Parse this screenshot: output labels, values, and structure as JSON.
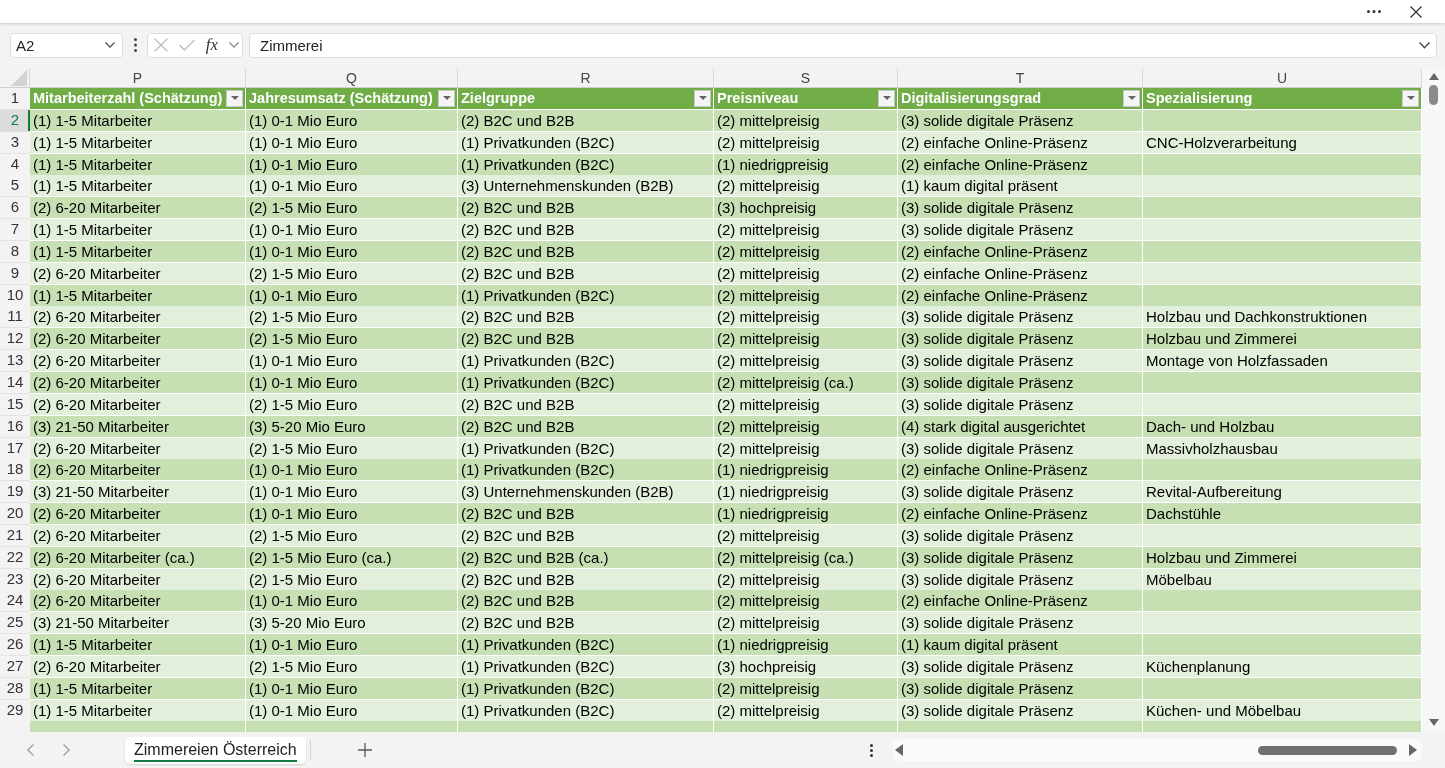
{
  "formula_bar": {
    "name_box": "A2",
    "function_label": "fx",
    "formula": "Zimmerei"
  },
  "sheet": {
    "columns": [
      {
        "letter": "P",
        "title": "Mitarbeiterzahl (Schätzung)"
      },
      {
        "letter": "Q",
        "title": "Jahresumsatz (Schätzung)"
      },
      {
        "letter": "R",
        "title": "Zielgruppe"
      },
      {
        "letter": "S",
        "title": "Preisniveau"
      },
      {
        "letter": "T",
        "title": "Digitalisierungsgrad"
      },
      {
        "letter": "U",
        "title": "Spezialisierung"
      }
    ],
    "header_row_number": "1",
    "rows": [
      {
        "number": "2",
        "selected": true,
        "cells": [
          "(1) 1-5 Mitarbeiter",
          "(1) 0-1 Mio Euro",
          "(2) B2C und B2B",
          "(2) mittelpreisig",
          "(3) solide digitale Präsenz"
        ]
      },
      {
        "number": "3",
        "selected": false,
        "cells": [
          "(1) 1-5 Mitarbeiter",
          "(1) 0-1 Mio Euro",
          "(1) Privatkunden (B2C)",
          "(2) mittelpreisig",
          "(2) einfache Online-Präsenz",
          "CNC-Holzverarbeitung"
        ]
      },
      {
        "number": "4",
        "selected": false,
        "cells": [
          "(1) 1-5 Mitarbeiter",
          "(1) 0-1 Mio Euro",
          "(1) Privatkunden (B2C)",
          "(1) niedrigpreisig",
          "(2) einfache Online-Präsenz"
        ]
      },
      {
        "number": "5",
        "selected": false,
        "cells": [
          "(1) 1-5 Mitarbeiter",
          "(1) 0-1 Mio Euro",
          "(3) Unternehmenskunden (B2B)",
          "(2) mittelpreisig",
          "(1) kaum digital präsent"
        ]
      },
      {
        "number": "6",
        "selected": false,
        "cells": [
          "(2) 6-20 Mitarbeiter",
          "(2) 1-5 Mio Euro",
          "(2) B2C und B2B",
          "(3) hochpreisig",
          "(3) solide digitale Präsenz"
        ]
      },
      {
        "number": "7",
        "selected": false,
        "cells": [
          "(1) 1-5 Mitarbeiter",
          "(1) 0-1 Mio Euro",
          "(2) B2C und B2B",
          "(2) mittelpreisig",
          "(3) solide digitale Präsenz"
        ]
      },
      {
        "number": "8",
        "selected": false,
        "cells": [
          "(1) 1-5 Mitarbeiter",
          "(1) 0-1 Mio Euro",
          "(2) B2C und B2B",
          "(2) mittelpreisig",
          "(2) einfache Online-Präsenz"
        ]
      },
      {
        "number": "9",
        "selected": false,
        "cells": [
          "(2) 6-20 Mitarbeiter",
          "(2) 1-5 Mio Euro",
          "(2) B2C und B2B",
          "(2) mittelpreisig",
          "(2) einfache Online-Präsenz"
        ]
      },
      {
        "number": "10",
        "selected": false,
        "cells": [
          "(1) 1-5 Mitarbeiter",
          "(1) 0-1 Mio Euro",
          "(1) Privatkunden (B2C)",
          "(2) mittelpreisig",
          "(2) einfache Online-Präsenz"
        ]
      },
      {
        "number": "11",
        "selected": false,
        "cells": [
          "(2) 6-20 Mitarbeiter",
          "(2) 1-5 Mio Euro",
          "(2) B2C und B2B",
          "(2) mittelpreisig",
          "(3) solide digitale Präsenz",
          "Holzbau und Dachkonstruktionen"
        ]
      },
      {
        "number": "12",
        "selected": false,
        "cells": [
          "(2) 6-20 Mitarbeiter",
          "(2) 1-5 Mio Euro",
          "(2) B2C und B2B",
          "(2) mittelpreisig",
          "(3) solide digitale Präsenz",
          "Holzbau und Zimmerei"
        ]
      },
      {
        "number": "13",
        "selected": false,
        "cells": [
          "(2) 6-20 Mitarbeiter",
          "(1) 0-1 Mio Euro",
          "(1) Privatkunden (B2C)",
          "(2) mittelpreisig",
          "(3) solide digitale Präsenz",
          "Montage von Holzfassaden"
        ]
      },
      {
        "number": "14",
        "selected": false,
        "cells": [
          "(2) 6-20 Mitarbeiter",
          "(1) 0-1 Mio Euro",
          "(1) Privatkunden (B2C)",
          "(2) mittelpreisig (ca.)",
          "(3) solide digitale Präsenz"
        ]
      },
      {
        "number": "15",
        "selected": false,
        "cells": [
          "(2) 6-20 Mitarbeiter",
          "(2) 1-5 Mio Euro",
          "(2) B2C und B2B",
          "(2) mittelpreisig",
          "(3) solide digitale Präsenz"
        ]
      },
      {
        "number": "16",
        "selected": false,
        "cells": [
          "(3) 21-50 Mitarbeiter",
          "(3) 5-20 Mio Euro",
          "(2) B2C und B2B",
          "(2) mittelpreisig",
          "(4) stark digital ausgerichtet",
          "Dach- und Holzbau"
        ]
      },
      {
        "number": "17",
        "selected": false,
        "cells": [
          "(2) 6-20 Mitarbeiter",
          "(2) 1-5 Mio Euro",
          "(1) Privatkunden (B2C)",
          "(2) mittelpreisig",
          "(3) solide digitale Präsenz",
          "Massivholzhausbau"
        ]
      },
      {
        "number": "18",
        "selected": false,
        "cells": [
          "(2) 6-20 Mitarbeiter",
          "(1) 0-1 Mio Euro",
          "(1) Privatkunden (B2C)",
          "(1) niedrigpreisig",
          "(2) einfache Online-Präsenz"
        ]
      },
      {
        "number": "19",
        "selected": false,
        "cells": [
          "(3) 21-50 Mitarbeiter",
          "(1) 0-1 Mio Euro",
          "(3) Unternehmenskunden (B2B)",
          "(1) niedrigpreisig",
          "(3) solide digitale Präsenz",
          "Revital-Aufbereitung"
        ]
      },
      {
        "number": "20",
        "selected": false,
        "cells": [
          "(2) 6-20 Mitarbeiter",
          "(1) 0-1 Mio Euro",
          "(2) B2C und B2B",
          "(1) niedrigpreisig",
          "(2) einfache Online-Präsenz",
          "Dachstühle"
        ]
      },
      {
        "number": "21",
        "selected": false,
        "cells": [
          "(2) 6-20 Mitarbeiter",
          "(2) 1-5 Mio Euro",
          "(2) B2C und B2B",
          "(2) mittelpreisig",
          "(3) solide digitale Präsenz"
        ]
      },
      {
        "number": "22",
        "selected": false,
        "cells": [
          "(2) 6-20 Mitarbeiter (ca.)",
          "(2) 1-5 Mio Euro (ca.)",
          "(2) B2C und B2B (ca.)",
          "(2) mittelpreisig (ca.)",
          "(3) solide digitale Präsenz",
          "Holzbau und Zimmerei"
        ]
      },
      {
        "number": "23",
        "selected": false,
        "cells": [
          "(2) 6-20 Mitarbeiter",
          "(2) 1-5 Mio Euro",
          "(2) B2C und B2B",
          "(2) mittelpreisig",
          "(3) solide digitale Präsenz",
          "Möbelbau"
        ]
      },
      {
        "number": "24",
        "selected": false,
        "cells": [
          "(2) 6-20 Mitarbeiter",
          "(1) 0-1 Mio Euro",
          "(2) B2C und B2B",
          "(2) mittelpreisig",
          "(2) einfache Online-Präsenz"
        ]
      },
      {
        "number": "25",
        "selected": false,
        "cells": [
          "(3) 21-50 Mitarbeiter",
          "(3) 5-20 Mio Euro",
          "(2) B2C und B2B",
          "(2) mittelpreisig",
          "(3) solide digitale Präsenz"
        ]
      },
      {
        "number": "26",
        "selected": false,
        "cells": [
          "(1) 1-5 Mitarbeiter",
          "(1) 0-1 Mio Euro",
          "(1) Privatkunden (B2C)",
          "(1) niedrigpreisig",
          "(1) kaum digital präsent"
        ]
      },
      {
        "number": "27",
        "selected": false,
        "cells": [
          "(2) 6-20 Mitarbeiter",
          "(2) 1-5 Mio Euro",
          "(1) Privatkunden (B2C)",
          "(3) hochpreisig",
          "(3) solide digitale Präsenz",
          "Küchenplanung"
        ]
      },
      {
        "number": "28",
        "selected": false,
        "cells": [
          "(1) 1-5 Mitarbeiter",
          "(1) 0-1 Mio Euro",
          "(1) Privatkunden (B2C)",
          "(2) mittelpreisig",
          "(3) solide digitale Präsenz"
        ]
      },
      {
        "number": "29",
        "selected": false,
        "cells": [
          "(1) 1-5 Mitarbeiter",
          "(1) 0-1 Mio Euro",
          "(1) Privatkunden (B2C)",
          "(2) mittelpreisig",
          "(3) solide digitale Präsenz",
          "Küchen- und Möbelbau"
        ]
      }
    ]
  },
  "sheet_tabs": [
    {
      "label": "Zimmereien Österreich",
      "selected": true
    }
  ]
}
